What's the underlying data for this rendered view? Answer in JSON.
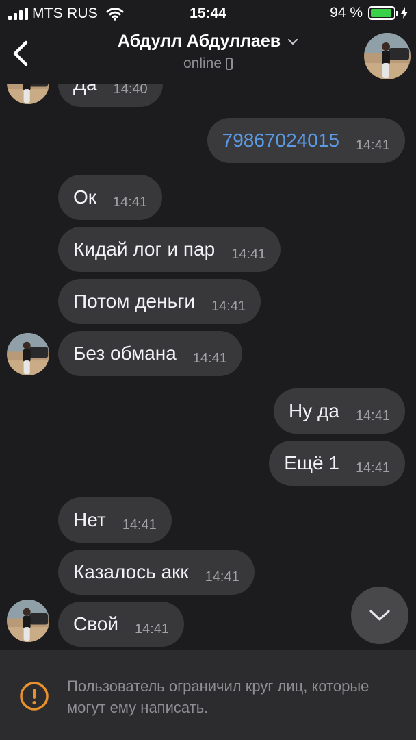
{
  "status_bar": {
    "carrier": "MTS RUS",
    "time": "15:44",
    "battery_percent": "94 %",
    "battery_level": 0.94,
    "battery_color": "#3ad14a"
  },
  "header": {
    "contact_name": "Абдулл Абдуллаев",
    "status": "online",
    "back_icon": "chevron-left-icon",
    "dropdown_icon": "chevron-down-icon",
    "device_icon": "phone-icon"
  },
  "messages": [
    {
      "dir": "in",
      "text": "Да",
      "time": "14:40"
    },
    {
      "dir": "out",
      "text": "79867024015",
      "time": "14:41",
      "link": true
    },
    {
      "dir": "in",
      "text": "Ок",
      "time": "14:41"
    },
    {
      "dir": "in",
      "text": "Кидай лог и пар",
      "time": "14:41"
    },
    {
      "dir": "in",
      "text": "Потом деньги",
      "time": "14:41"
    },
    {
      "dir": "in",
      "text": "Без обмана",
      "time": "14:41"
    },
    {
      "dir": "out",
      "text": "Ну да",
      "time": "14:41"
    },
    {
      "dir": "out",
      "text": "Ещё 1",
      "time": "14:41"
    },
    {
      "dir": "in",
      "text": "Нет",
      "time": "14:41"
    },
    {
      "dir": "in",
      "text": "Казалось акк",
      "time": "14:41"
    },
    {
      "dir": "in",
      "text": "Свой",
      "time": "14:41"
    }
  ],
  "scroll_button_icon": "chevron-down-icon",
  "footer": {
    "icon": "warning-icon",
    "icon_color": "#e8912d",
    "notice": "Пользователь ограничил круг лиц, которые могут ему написать."
  },
  "colors": {
    "background": "#1c1c1e",
    "bubble": "#38383a",
    "link": "#5b9be6"
  }
}
